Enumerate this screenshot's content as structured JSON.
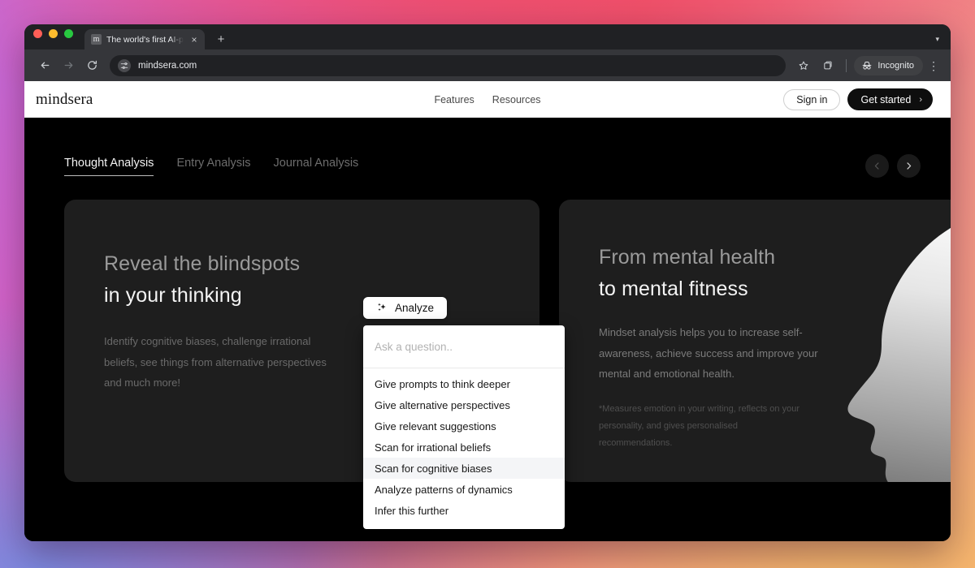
{
  "browser": {
    "tab": {
      "favicon_letter": "m",
      "title": "The world's first AI-powered j",
      "close_label": "×"
    },
    "new_tab_label": "+",
    "tabstrip_caret": "▾",
    "toolbar": {
      "back_label": "←",
      "forward_label": "→",
      "reload_label": "↻",
      "url": "mindsera.com",
      "bookmark_label": "☆",
      "split_label": "⧉",
      "incognito_label": "Incognito",
      "menu_label": "⋮"
    }
  },
  "site": {
    "logo": "mindsera",
    "nav": [
      {
        "label": "Features"
      },
      {
        "label": "Resources"
      }
    ],
    "sign_in_label": "Sign in",
    "get_started_label": "Get started",
    "get_started_chevron": "›"
  },
  "hero": {
    "tabs": [
      {
        "label": "Thought Analysis",
        "active": true
      },
      {
        "label": "Entry Analysis",
        "active": false
      },
      {
        "label": "Journal Analysis",
        "active": false
      }
    ],
    "carousel": {
      "prev_label": "‹",
      "next_label": "›"
    },
    "left_card": {
      "heading_line1": "Reveal the blindspots",
      "heading_line2": "in your thinking",
      "body": "Identify cognitive biases, challenge irrational beliefs, see things from alternative perspectives and much more!"
    },
    "right_card": {
      "heading_line1": "From mental health",
      "heading_line2": "to mental fitness",
      "body": "Mindset analysis helps you to increase self-awareness, achieve success and improve your mental and emotional health.",
      "note": "*Measures emotion in your writing, reflects on your personality, and gives personalised recommendations."
    },
    "analyze": {
      "button_label": "Analyze",
      "input_placeholder": "Ask a question..",
      "input_value": "",
      "options": [
        {
          "label": "Give prompts to think deeper",
          "hovered": false
        },
        {
          "label": "Give alternative perspectives",
          "hovered": false
        },
        {
          "label": "Give relevant suggestions",
          "hovered": false
        },
        {
          "label": "Scan for irrational beliefs",
          "hovered": false
        },
        {
          "label": "Scan for cognitive biases",
          "hovered": true
        },
        {
          "label": "Analyze patterns of dynamics",
          "hovered": false
        },
        {
          "label": "Infer this further",
          "hovered": false
        }
      ]
    }
  },
  "colors": {
    "page_background": "#000000",
    "card_background": "#1e1e1e",
    "accent_white": "#ffffff",
    "browser_chrome": "#35363a",
    "highlight_row": "#f4f5f7"
  }
}
